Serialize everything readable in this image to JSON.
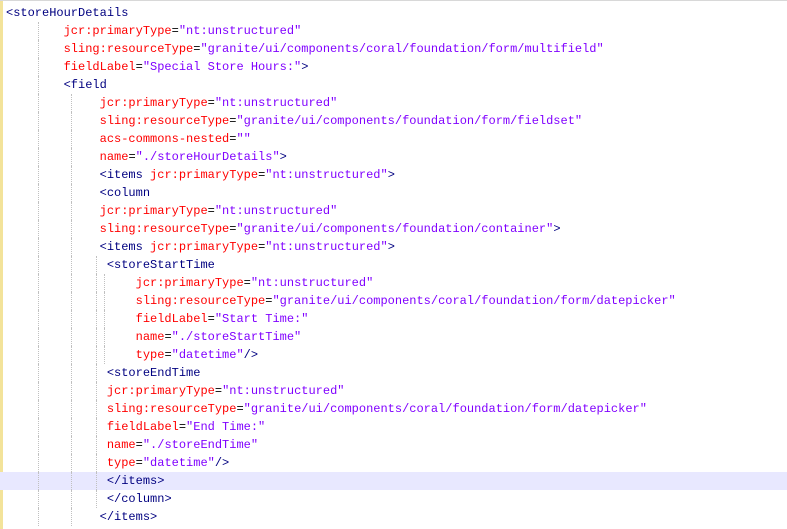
{
  "editor": {
    "lines": [
      {
        "indent": 0,
        "guides": 0,
        "tag": "<storeHourDetails",
        "attr": "",
        "value": "",
        "close": ""
      },
      {
        "indent": 8,
        "guides": 1,
        "tag": "",
        "attr": "jcr:primaryType",
        "value": "\"nt:unstructured\"",
        "close": ""
      },
      {
        "indent": 8,
        "guides": 1,
        "tag": "",
        "attr": "sling:resourceType",
        "value": "\"granite/ui/components/coral/foundation/form/multifield\"",
        "close": ""
      },
      {
        "indent": 8,
        "guides": 1,
        "tag": "",
        "attr": "fieldLabel",
        "value": "\"Special Store Hours:\"",
        "close": ">"
      },
      {
        "indent": 8,
        "guides": 1,
        "tag": "<field",
        "attr": "",
        "value": "",
        "close": ""
      },
      {
        "indent": 13,
        "guides": 2,
        "tag": "",
        "attr": "jcr:primaryType",
        "value": "\"nt:unstructured\"",
        "close": ""
      },
      {
        "indent": 13,
        "guides": 2,
        "tag": "",
        "attr": "sling:resourceType",
        "value": "\"granite/ui/components/foundation/form/fieldset\"",
        "close": ""
      },
      {
        "indent": 13,
        "guides": 2,
        "tag": "",
        "attr": "acs-commons-nested",
        "value": "\"\"",
        "close": ""
      },
      {
        "indent": 13,
        "guides": 2,
        "tag": "",
        "attr": "name",
        "value": "\"./storeHourDetails\"",
        "close": ">"
      },
      {
        "indent": 13,
        "guides": 2,
        "tag": "<items ",
        "attr": "jcr:primaryType",
        "value": "\"nt:unstructured\"",
        "close": ">"
      },
      {
        "indent": 13,
        "guides": 2,
        "tag": "<column",
        "attr": "",
        "value": "",
        "close": ""
      },
      {
        "indent": 13,
        "guides": 2,
        "tag": "",
        "attr": "jcr:primaryType",
        "value": "\"nt:unstructured\"",
        "close": ""
      },
      {
        "indent": 13,
        "guides": 2,
        "tag": "",
        "attr": "sling:resourceType",
        "value": "\"granite/ui/components/foundation/container\"",
        "close": ">"
      },
      {
        "indent": 13,
        "guides": 2,
        "tag": "<items ",
        "attr": "jcr:primaryType",
        "value": "\"nt:unstructured\"",
        "close": ">"
      },
      {
        "indent": 14,
        "guides": 3,
        "tag": "<storeStartTime",
        "attr": "",
        "value": "",
        "close": ""
      },
      {
        "indent": 18,
        "guides": 4,
        "tag": "",
        "attr": "jcr:primaryType",
        "value": "\"nt:unstructured\"",
        "close": ""
      },
      {
        "indent": 18,
        "guides": 4,
        "tag": "",
        "attr": "sling:resourceType",
        "value": "\"granite/ui/components/coral/foundation/form/datepicker\"",
        "close": ""
      },
      {
        "indent": 18,
        "guides": 4,
        "tag": "",
        "attr": "fieldLabel",
        "value": "\"Start Time:\"",
        "close": ""
      },
      {
        "indent": 18,
        "guides": 4,
        "tag": "",
        "attr": "name",
        "value": "\"./storeStartTime\"",
        "close": ""
      },
      {
        "indent": 18,
        "guides": 4,
        "tag": "",
        "attr": "type",
        "value": "\"datetime\"",
        "close": "/>"
      },
      {
        "indent": 14,
        "guides": 3,
        "tag": "<storeEndTime",
        "attr": "",
        "value": "",
        "close": ""
      },
      {
        "indent": 14,
        "guides": 3,
        "tag": "",
        "attr": "jcr:primaryType",
        "value": "\"nt:unstructured\"",
        "close": ""
      },
      {
        "indent": 14,
        "guides": 3,
        "tag": "",
        "attr": "sling:resourceType",
        "value": "\"granite/ui/components/coral/foundation/form/datepicker\"",
        "close": ""
      },
      {
        "indent": 14,
        "guides": 3,
        "tag": "",
        "attr": "fieldLabel",
        "value": "\"End Time:\"",
        "close": ""
      },
      {
        "indent": 14,
        "guides": 3,
        "tag": "",
        "attr": "name",
        "value": "\"./storeEndTime\"",
        "close": ""
      },
      {
        "indent": 14,
        "guides": 3,
        "tag": "",
        "attr": "type",
        "value": "\"datetime\"",
        "close": "/>"
      },
      {
        "indent": 14,
        "guides": 3,
        "tag": "</items>",
        "attr": "",
        "value": "",
        "close": "",
        "current": true
      },
      {
        "indent": 14,
        "guides": 3,
        "tag": "</column>",
        "attr": "",
        "value": "",
        "close": ""
      },
      {
        "indent": 13,
        "guides": 2,
        "tag": "</items>",
        "attr": "",
        "value": "",
        "close": ""
      }
    ]
  }
}
